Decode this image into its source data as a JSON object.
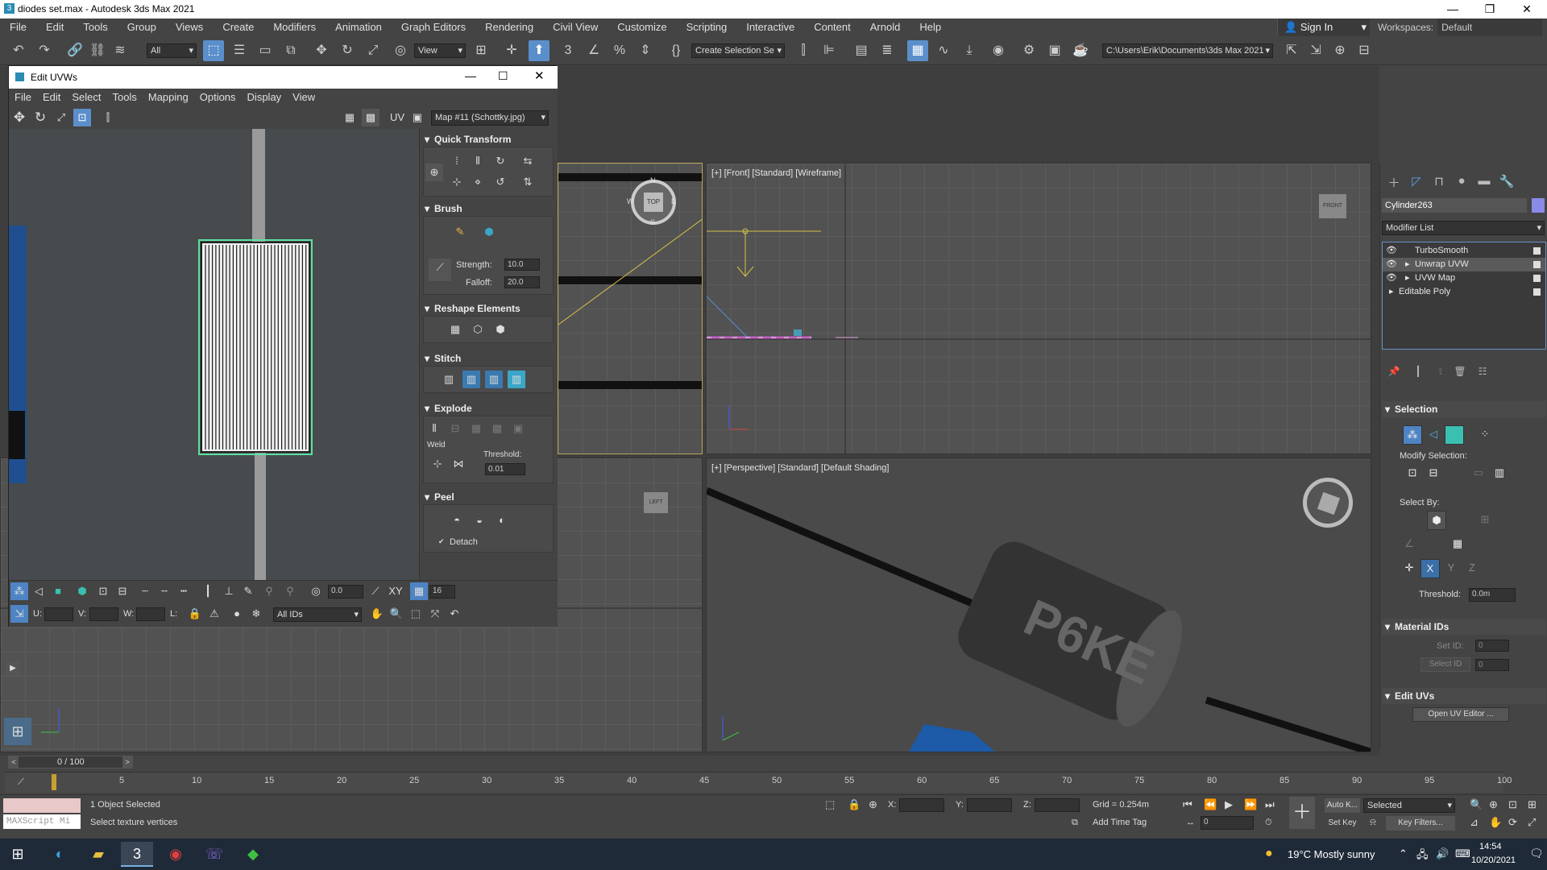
{
  "app": {
    "title": "diodes set.max - Autodesk 3ds Max 2021"
  },
  "menu": [
    "File",
    "Edit",
    "Tools",
    "Group",
    "Views",
    "Create",
    "Modifiers",
    "Animation",
    "Graph Editors",
    "Rendering",
    "Civil View",
    "Customize",
    "Scripting",
    "Interactive",
    "Content",
    "Arnold",
    "Help"
  ],
  "signin": "Sign In",
  "workspaces": {
    "label": "Workspaces:",
    "value": "Default"
  },
  "toolbar": {
    "filter": "All",
    "refcoord": "View",
    "selset": "Create Selection Se",
    "path": "C:\\Users\\Erik\\Documents\\3ds Max 2021"
  },
  "uvw": {
    "title": "Edit UVWs",
    "menu": [
      "File",
      "Edit",
      "Select",
      "Tools",
      "Mapping",
      "Options",
      "Display",
      "View"
    ],
    "uv_label": "UV",
    "map": "Map #11 (Schottky.jpg)",
    "sections": {
      "quick": "Quick Transform",
      "brush": "Brush",
      "reshape": "Reshape Elements",
      "stitch": "Stitch",
      "explode": "Explode",
      "peel": "Peel"
    },
    "brush": {
      "strength_label": "Strength:",
      "strength": "10.0",
      "falloff_label": "Falloff:",
      "falloff": "20.0"
    },
    "weld": {
      "label": "Weld",
      "threshold_label": "Threshold:",
      "threshold": "0.01"
    },
    "peel": {
      "detach": "Detach"
    },
    "bottom": {
      "spin1": "0.0",
      "xy": "XY",
      "spin2": "16",
      "u": "U:",
      "v": "V:",
      "w": "W:",
      "l": "L:",
      "ids": "All IDs"
    }
  },
  "viewports": {
    "front": "[+] [Front] [Standard] [Wireframe]",
    "persp": "[+] [Perspective] [Standard] [Default Shading]",
    "top_cube": "TOP",
    "left_cube": "LEFT",
    "front_cube": "FRONT",
    "compass": {
      "n": "N",
      "s": "S",
      "e": "E",
      "w": "W"
    }
  },
  "cmd": {
    "object": "Cylinder263",
    "modlist": "Modifier List",
    "modifiers": [
      "TurboSmooth",
      "Unwrap UVW",
      "UVW Map",
      "Editable Poly"
    ],
    "selection": "Selection",
    "modify_sel": "Modify Selection:",
    "select_by": "Select By:",
    "threshold_label": "Threshold:",
    "threshold": "0.0m",
    "material_ids": "Material IDs",
    "set_id": "Set ID:",
    "set_id_val": "0",
    "select_id": "Select ID",
    "select_id_val": "0",
    "edit_uvs": "Edit UVs",
    "open_uv": "Open UV Editor ..."
  },
  "timeline": {
    "frame": "0 / 100",
    "ticks": [
      "5",
      "10",
      "15",
      "20",
      "25",
      "30",
      "35",
      "40",
      "45",
      "50",
      "55",
      "60",
      "65",
      "70",
      "75",
      "80",
      "85",
      "90",
      "95",
      "100"
    ]
  },
  "status": {
    "selected": "1 Object Selected",
    "prompt": "Select texture vertices",
    "maxscript": "MAXScript Mi",
    "x": "X:",
    "y": "Y:",
    "z": "Z:",
    "grid": "Grid = 0.254m",
    "add_time_tag": "Add Time Tag",
    "autokey": "Auto K...",
    "selected_dd": "Selected",
    "setkey": "Set Key",
    "keyfilters": "Key Filters...",
    "frame": "0"
  },
  "taskbar": {
    "weather": "19°C  Mostly sunny",
    "time": "14:54",
    "date": "10/20/2021"
  }
}
